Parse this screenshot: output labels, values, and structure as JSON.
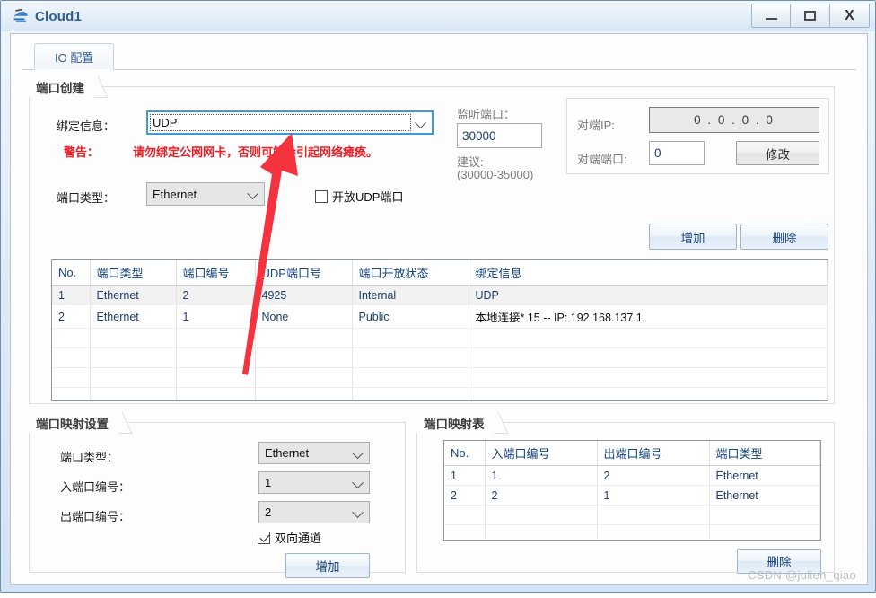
{
  "window": {
    "title": "Cloud1",
    "icon": "cloud-icon",
    "minimize_label": "—",
    "maximize_label": "□",
    "close_label": "X"
  },
  "tabs": [
    {
      "label": "IO 配置",
      "active": true
    }
  ],
  "port_create": {
    "group_title": "端口创建",
    "bind_info_label": "绑定信息：",
    "bind_info_value": "UDP",
    "warning_label": "警告：",
    "warning_text": "请勿绑定公网网卡，否则可能会引起网络瘫痪。",
    "port_type_label": "端口类型：",
    "port_type_value": "Ethernet",
    "open_udp_checkbox_label": "开放UDP端口",
    "open_udp_checked": false,
    "listen_port_label": "监听端口：",
    "listen_port_value": "30000",
    "suggest_label": "建议:",
    "suggest_range": "(30000-35000)",
    "peer_ip_label": "对端IP:",
    "peer_ip_value": "0  .  0  .  0  .  0",
    "peer_port_label": "对端端口:",
    "peer_port_value": "0",
    "modify_button": "修改",
    "add_button": "增加",
    "delete_button": "删除"
  },
  "port_table": {
    "headers": [
      "No.",
      "端口类型",
      "端口编号",
      "UDP端口号",
      "端口开放状态",
      "绑定信息"
    ],
    "rows": [
      {
        "no": "1",
        "type": "Ethernet",
        "num": "2",
        "udp": "4925",
        "state": "Internal",
        "bind": "UDP",
        "selected": true
      },
      {
        "no": "2",
        "type": "Ethernet",
        "num": "1",
        "udp": "None",
        "state": "Public",
        "bind": "本地连接* 15 -- IP: 192.168.137.1",
        "selected": false
      }
    ],
    "empty_rows": 5
  },
  "map_settings": {
    "group_title": "端口映射设置",
    "port_type_label": "端口类型：",
    "port_type_value": "Ethernet",
    "in_port_label": "入端口编号：",
    "in_port_value": "1",
    "out_port_label": "出端口编号：",
    "out_port_value": "2",
    "bidir_label": "双向通道",
    "bidir_checked": true,
    "add_button": "增加"
  },
  "map_table": {
    "group_title": "端口映射表",
    "headers": [
      "No.",
      "入端口编号",
      "出端口编号",
      "端口类型"
    ],
    "rows": [
      {
        "no": "1",
        "in": "1",
        "out": "2",
        "type": "Ethernet"
      },
      {
        "no": "2",
        "in": "2",
        "out": "1",
        "type": "Ethernet"
      }
    ],
    "empty_rows": 3,
    "delete_button": "删除"
  },
  "annotation": {
    "arrow_color": "#f5333f"
  },
  "watermark": "CSDN @julien_qiao"
}
